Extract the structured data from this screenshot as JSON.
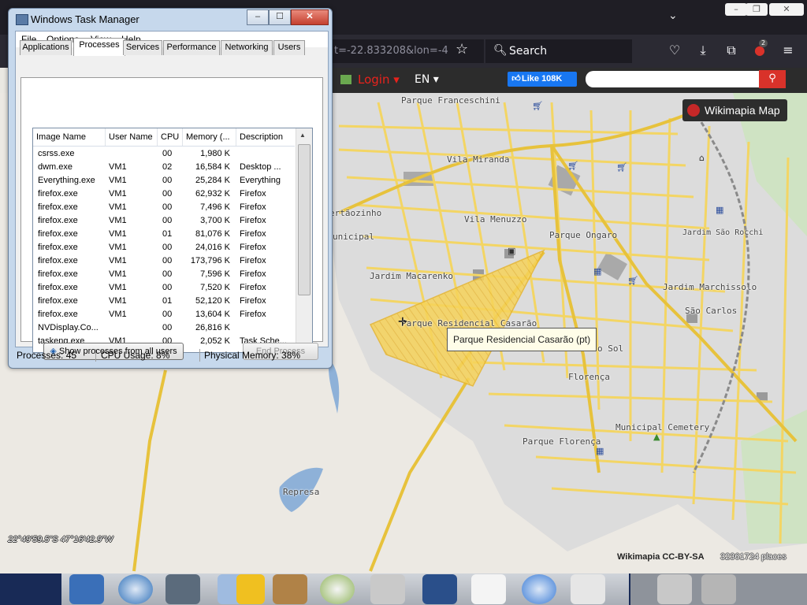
{
  "browser": {
    "url_fragment": "t=-22.833208&lon=-4",
    "search_placeholder": "Search",
    "extension_badge": "2"
  },
  "wikimapia": {
    "login_label": "Login ▾",
    "language_label": "EN ▾",
    "fb_like_label": "Like 108K",
    "map_badge_label": "Wikimapia Map",
    "tooltip": "Parque Residencial Casarão (pt)",
    "coordinates": "22°49'59.5\"S 47°16'42.9\"W",
    "license": "Wikimapia CC-BY-SA",
    "places_count": "32361724 places",
    "place_labels": {
      "parque_franceschini": "Parque Franceschini",
      "vila_miranda": "Vila Miranda",
      "sertaozinho": "ertãozinho",
      "municipal": "unicipal",
      "vila_menuzzo": "Vila Menuzzo",
      "parque_ongaro": "Parque Ongaro",
      "jardim_sao_rocchi": "Jardim São Rocchi",
      "jardim_macarenko": "Jardim Macarenko",
      "jardim_marchissolo": "Jardim Marchissolo",
      "sao_carlos": "São Carlos",
      "parque_residencial_casarao": "Parque Residencial Casarão",
      "do_sol": "o Sol",
      "florenca": "Florença",
      "municipal_cemetery": "Municipal Cemetery",
      "parque_florenca": "Parque Florença",
      "represa": "Represa"
    }
  },
  "task_manager": {
    "title": "Windows Task Manager",
    "menu": [
      "File",
      "Options",
      "View",
      "Help"
    ],
    "tabs": [
      "Applications",
      "Processes",
      "Services",
      "Performance",
      "Networking",
      "Users"
    ],
    "active_tab": "Processes",
    "columns": [
      "Image Name",
      "User Name",
      "CPU",
      "Memory (...",
      "Description"
    ],
    "rows": [
      {
        "name": "csrss.exe",
        "user": "",
        "cpu": "00",
        "mem": "1,980 K",
        "desc": ""
      },
      {
        "name": "dwm.exe",
        "user": "VM1",
        "cpu": "02",
        "mem": "16,584 K",
        "desc": "Desktop ..."
      },
      {
        "name": "Everything.exe",
        "user": "VM1",
        "cpu": "00",
        "mem": "25,284 K",
        "desc": "Everything"
      },
      {
        "name": "firefox.exe",
        "user": "VM1",
        "cpu": "00",
        "mem": "62,932 K",
        "desc": "Firefox"
      },
      {
        "name": "firefox.exe",
        "user": "VM1",
        "cpu": "00",
        "mem": "7,496 K",
        "desc": "Firefox"
      },
      {
        "name": "firefox.exe",
        "user": "VM1",
        "cpu": "00",
        "mem": "3,700 K",
        "desc": "Firefox"
      },
      {
        "name": "firefox.exe",
        "user": "VM1",
        "cpu": "01",
        "mem": "81,076 K",
        "desc": "Firefox"
      },
      {
        "name": "firefox.exe",
        "user": "VM1",
        "cpu": "00",
        "mem": "24,016 K",
        "desc": "Firefox"
      },
      {
        "name": "firefox.exe",
        "user": "VM1",
        "cpu": "00",
        "mem": "173,796 K",
        "desc": "Firefox"
      },
      {
        "name": "firefox.exe",
        "user": "VM1",
        "cpu": "00",
        "mem": "7,596 K",
        "desc": "Firefox"
      },
      {
        "name": "firefox.exe",
        "user": "VM1",
        "cpu": "00",
        "mem": "7,520 K",
        "desc": "Firefox"
      },
      {
        "name": "firefox.exe",
        "user": "VM1",
        "cpu": "01",
        "mem": "52,120 K",
        "desc": "Firefox"
      },
      {
        "name": "firefox.exe",
        "user": "VM1",
        "cpu": "00",
        "mem": "13,604 K",
        "desc": "Firefox"
      },
      {
        "name": "NVDisplay.Co...",
        "user": "",
        "cpu": "00",
        "mem": "26,816 K",
        "desc": ""
      },
      {
        "name": "taskeng.exe",
        "user": "VM1",
        "cpu": "00",
        "mem": "2,052 K",
        "desc": "Task Sche..."
      }
    ],
    "show_all_label": "Show processes from all users",
    "end_process_label": "End Process",
    "status": {
      "processes": "Processes: 45",
      "cpu": "CPU Usage: 8%",
      "memory": "Physical Memory: 38%"
    }
  }
}
